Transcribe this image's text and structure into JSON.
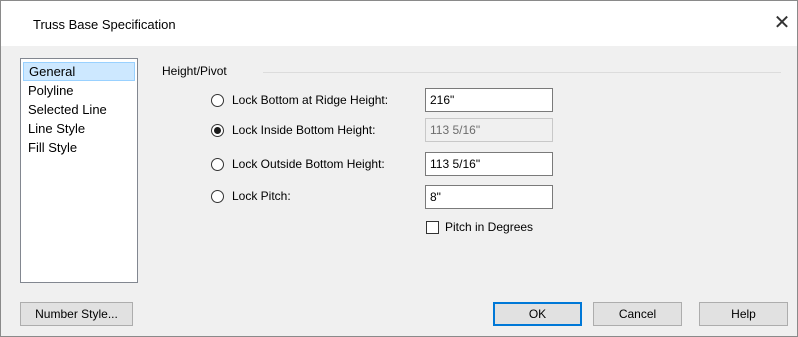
{
  "window": {
    "title": "Truss Base Specification",
    "close_glyph": "✕"
  },
  "sidebar": {
    "items": [
      {
        "label": "General",
        "selected": true
      },
      {
        "label": "Polyline"
      },
      {
        "label": "Selected Line"
      },
      {
        "label": "Line Style"
      },
      {
        "label": "Fill Style"
      }
    ]
  },
  "group": {
    "label": "Height/Pivot"
  },
  "options": [
    {
      "label": "Lock Bottom at Ridge Height:",
      "value": "216\"",
      "checked": false,
      "enabled": true
    },
    {
      "label": "Lock Inside Bottom Height:",
      "value": "113 5/16\"",
      "checked": true,
      "enabled": false
    },
    {
      "label": "Lock Outside Bottom Height:",
      "value": "113 5/16\"",
      "checked": false,
      "enabled": true
    },
    {
      "label": "Lock Pitch:",
      "value": "8\"",
      "checked": false,
      "enabled": true
    }
  ],
  "pitch_in_degrees": {
    "label": "Pitch in Degrees",
    "checked": false
  },
  "buttons": {
    "number_style": "Number Style...",
    "ok": "OK",
    "cancel": "Cancel",
    "help": "Help"
  },
  "colors": {
    "accent": "#0078d7",
    "selection_bg": "#cde8ff",
    "dialog_bg": "#f0f0f0"
  }
}
